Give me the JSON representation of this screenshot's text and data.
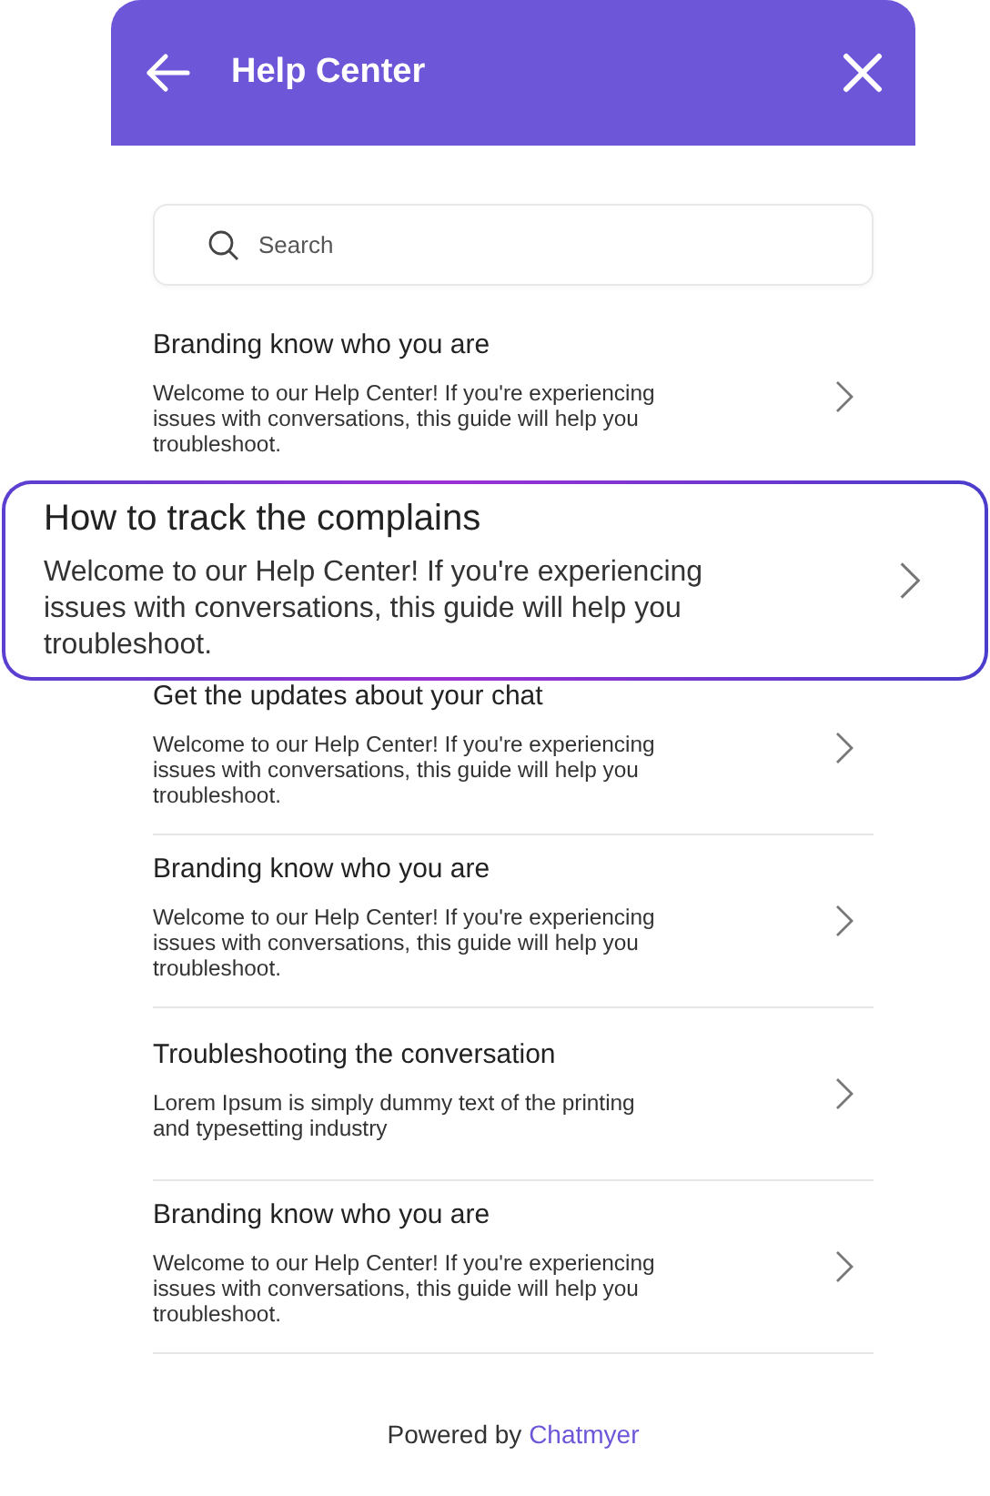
{
  "header": {
    "title": "Help Center"
  },
  "search": {
    "placeholder": "Search"
  },
  "articles": [
    {
      "title": "Branding know who you are",
      "summary": "Welcome to our Help Center! If you're experiencing issues with conversations, this guide will help you troubleshoot."
    },
    {
      "title": "Get the updates about your chat",
      "summary": "Welcome to our Help Center! If you're experiencing issues with conversations, this guide will help you troubleshoot."
    },
    {
      "title": "Branding know who you are",
      "summary": "Welcome to our Help Center! If you're experiencing issues with conversations, this guide will help you troubleshoot."
    },
    {
      "title": "Troubleshooting the conversation",
      "summary": "Lorem Ipsum is simply dummy text of the printing and typesetting industry"
    },
    {
      "title": "Branding know who you are",
      "summary": "Welcome to our Help Center! If you're experiencing issues with conversations, this guide will help you troubleshoot."
    }
  ],
  "highlighted_article": {
    "title": "How to track the complains",
    "summary": "Welcome to our Help Center! If you're experiencing issues with conversations, this guide will help you troubleshoot."
  },
  "footer": {
    "prefix": "Powered by",
    "brand": "Chatmyer"
  }
}
